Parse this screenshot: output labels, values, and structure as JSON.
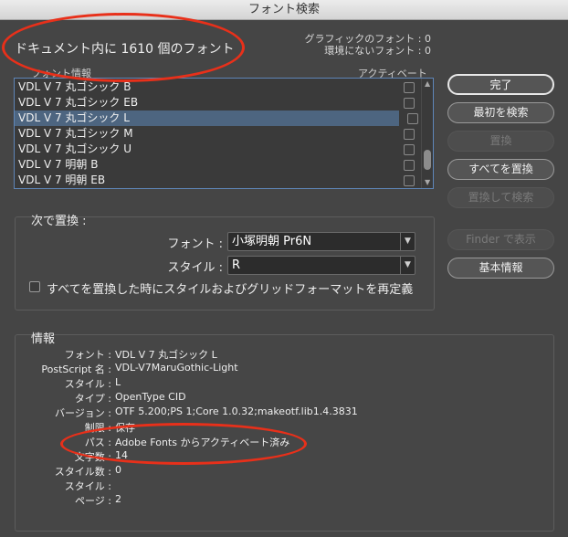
{
  "window": {
    "title": "フォント検索"
  },
  "header": {
    "count_text": "ドキュメント内に 1610 個のフォント",
    "missing_graphic": "グラフィックのフォント : 0",
    "missing_env": "環境にないフォント : 0"
  },
  "list": {
    "col_font": "フォント情報",
    "col_activate": "アクティベート",
    "rows": [
      "VDL V 7 丸ゴシック B",
      "VDL V 7 丸ゴシック EB",
      "VDL V 7 丸ゴシック L",
      "VDL V 7 丸ゴシック M",
      "VDL V 7 丸ゴシック U",
      "VDL V 7 明朝 B",
      "VDL V 7 明朝 EB"
    ],
    "selected_index": 2
  },
  "buttons": {
    "done": "完了",
    "find_first": "最初を検索",
    "replace": "置換",
    "replace_all": "すべてを置換",
    "replace_find": "置換して検索",
    "reveal_finder": "Finder で表示",
    "more_info": "基本情報"
  },
  "replace": {
    "title": "次で置換 :",
    "font_label": "フォント :",
    "font_value": "小塚明朝 Pr6N",
    "style_label": "スタイル :",
    "style_value": "R",
    "redefine_label": "すべてを置換した時にスタイルおよびグリッドフォーマットを再定義"
  },
  "info": {
    "title": "情報",
    "rows": [
      {
        "k": "フォント :",
        "v": "VDL V 7 丸ゴシック L"
      },
      {
        "k": "PostScript 名 :",
        "v": "VDL-V7MaruGothic-Light"
      },
      {
        "k": "スタイル :",
        "v": "L"
      },
      {
        "k": "タイプ :",
        "v": "OpenType CID"
      },
      {
        "k": "バージョン :",
        "v": "OTF 5.200;PS 1;Core 1.0.32;makeotf.lib1.4.3831"
      },
      {
        "k": "制限 :",
        "v": "保存"
      },
      {
        "k": "パス :",
        "v": "Adobe Fonts からアクティベート済み"
      },
      {
        "k": "文字数 :",
        "v": "14"
      },
      {
        "k": "スタイル数 :",
        "v": "0"
      },
      {
        "k": "スタイル :",
        "v": ""
      },
      {
        "k": "ページ :",
        "v": "2"
      }
    ]
  },
  "annotation_color": "#e8301a"
}
